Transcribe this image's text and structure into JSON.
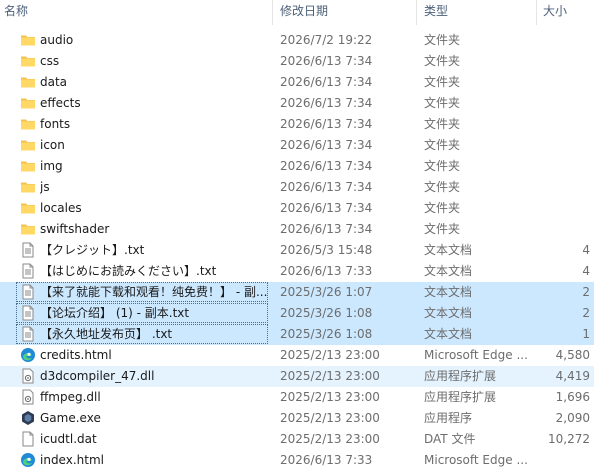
{
  "columns": {
    "name": "名称",
    "modified": "修改日期",
    "type": "类型",
    "size": "大小"
  },
  "files": [
    {
      "name": "audio",
      "modified": "2026/7/2 19:22",
      "type": "文件夹",
      "size": "",
      "icon": "folder-icon"
    },
    {
      "name": "css",
      "modified": "2026/6/13 7:34",
      "type": "文件夹",
      "size": "",
      "icon": "folder-icon"
    },
    {
      "name": "data",
      "modified": "2026/6/13 7:34",
      "type": "文件夹",
      "size": "",
      "icon": "folder-icon"
    },
    {
      "name": "effects",
      "modified": "2026/6/13 7:34",
      "type": "文件夹",
      "size": "",
      "icon": "folder-icon"
    },
    {
      "name": "fonts",
      "modified": "2026/6/13 7:34",
      "type": "文件夹",
      "size": "",
      "icon": "folder-icon"
    },
    {
      "name": "icon",
      "modified": "2026/6/13 7:34",
      "type": "文件夹",
      "size": "",
      "icon": "folder-icon"
    },
    {
      "name": "img",
      "modified": "2026/6/13 7:34",
      "type": "文件夹",
      "size": "",
      "icon": "folder-icon"
    },
    {
      "name": "js",
      "modified": "2026/6/13 7:34",
      "type": "文件夹",
      "size": "",
      "icon": "folder-icon"
    },
    {
      "name": "locales",
      "modified": "2026/6/13 7:34",
      "type": "文件夹",
      "size": "",
      "icon": "folder-icon"
    },
    {
      "name": "swiftshader",
      "modified": "2026/6/13 7:34",
      "type": "文件夹",
      "size": "",
      "icon": "folder-icon"
    },
    {
      "name": "【クレジット】.txt",
      "modified": "2026/5/3 15:48",
      "type": "文本文档",
      "size": "4",
      "icon": "text-file-icon"
    },
    {
      "name": "【はじめにお読みください】.txt",
      "modified": "2026/6/13 7:33",
      "type": "文本文档",
      "size": "4",
      "icon": "text-file-icon"
    },
    {
      "name": "【来了就能下载和观看！纯免费！】 - 副...",
      "modified": "2025/3/26 1:07",
      "type": "文本文档",
      "size": "2",
      "icon": "text-file-icon",
      "state": "selected"
    },
    {
      "name": "【论坛介绍】 (1) - 副本.txt",
      "modified": "2025/3/26 1:08",
      "type": "文本文档",
      "size": "2",
      "icon": "text-file-icon",
      "state": "selected"
    },
    {
      "name": "【永久地址发布页】 .txt",
      "modified": "2025/3/26 1:08",
      "type": "文本文档",
      "size": "1",
      "icon": "text-file-icon",
      "state": "selected"
    },
    {
      "name": "credits.html",
      "modified": "2025/2/13 23:00",
      "type": "Microsoft Edge ...",
      "size": "4,580",
      "icon": "edge-icon"
    },
    {
      "name": "d3dcompiler_47.dll",
      "modified": "2025/2/13 23:00",
      "type": "应用程序扩展",
      "size": "4,419",
      "icon": "dll-file-icon",
      "state": "hover"
    },
    {
      "name": "ffmpeg.dll",
      "modified": "2025/2/13 23:00",
      "type": "应用程序扩展",
      "size": "1,696",
      "icon": "dll-file-icon"
    },
    {
      "name": "Game.exe",
      "modified": "2025/2/13 23:00",
      "type": "应用程序",
      "size": "2,090",
      "icon": "game-exe-icon"
    },
    {
      "name": "icudtl.dat",
      "modified": "2025/2/13 23:00",
      "type": "DAT 文件",
      "size": "10,272",
      "icon": "file-icon"
    },
    {
      "name": "index.html",
      "modified": "2026/6/13 7:33",
      "type": "Microsoft Edge ...",
      "size": "",
      "icon": "edge-icon"
    }
  ]
}
